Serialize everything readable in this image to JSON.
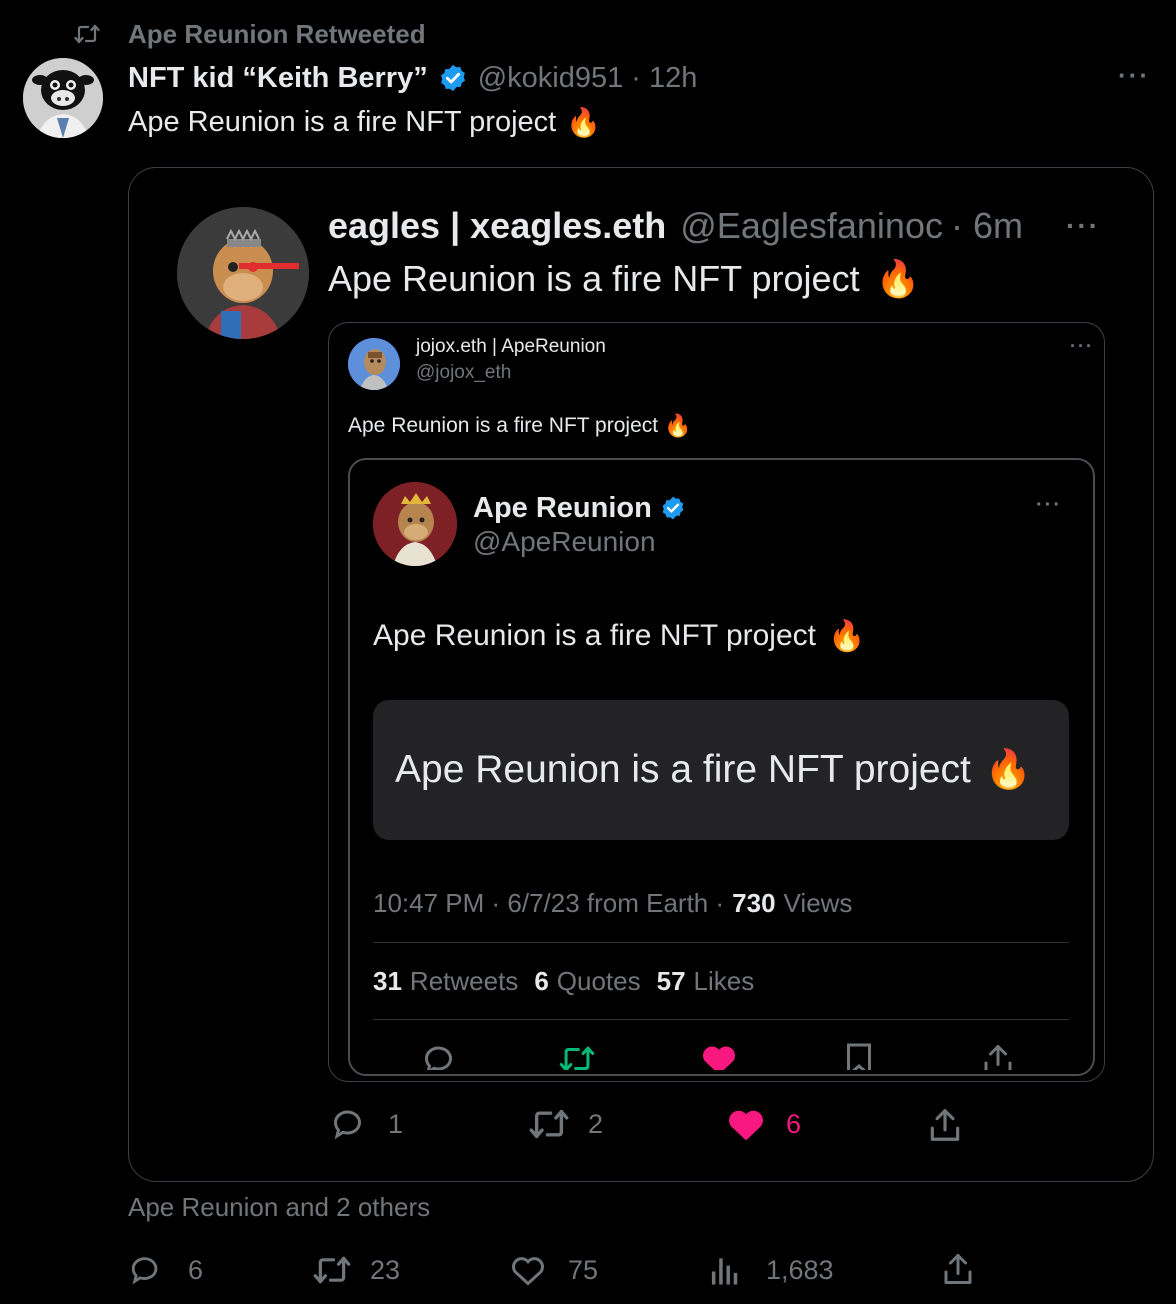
{
  "retweet_banner": {
    "text": "Ape Reunion Retweeted"
  },
  "main_tweet": {
    "display_name": "NFT kid “Keith Berry”",
    "handle": "@kokid951",
    "time": "· 12h",
    "text": "Ape Reunion is a fire NFT project",
    "emoji": "🔥",
    "more": "···"
  },
  "quote1": {
    "display_name": "eagles | xeagles.eth",
    "handle": "@Eaglesfaninoc",
    "time": "· 6m",
    "text": "Ape Reunion is a fire NFT project",
    "more": "···"
  },
  "quote2": {
    "display_name": "jojox.eth | ApeReunion",
    "handle": "@jojox_eth",
    "text": "Ape Reunion is a fire NFT project",
    "more": "···"
  },
  "quote3": {
    "display_name": "Ape Reunion",
    "handle": "@ApeReunion",
    "text": "Ape Reunion is a fire NFT project",
    "card_text": "Ape Reunion is a fire NFT project",
    "timestamp": "10:47 PM · 6/7/23 from Earth ·",
    "views_count": "730",
    "views_label": "Views",
    "retweets_count": "31",
    "retweets_label": "Retweets",
    "quotes_count": "6",
    "quotes_label": "Quotes",
    "likes_count": "57",
    "likes_label": "Likes",
    "more": "···"
  },
  "quote1_actions": {
    "replies": "1",
    "retweets": "2",
    "likes": "6"
  },
  "social_context": "Ape Reunion and 2 others",
  "main_actions": {
    "replies": "6",
    "retweets": "23",
    "likes": "75",
    "views": "1,683"
  },
  "colors": {
    "like_pink": "#f91880",
    "retweet_green": "#00ba7c",
    "verified_blue": "#1d9bf0",
    "muted": "#71767b"
  },
  "icons": [
    "retweet-icon",
    "verified-icon",
    "reply-icon",
    "like-icon",
    "views-icon",
    "share-icon",
    "bookmark-icon",
    "more-icon"
  ]
}
